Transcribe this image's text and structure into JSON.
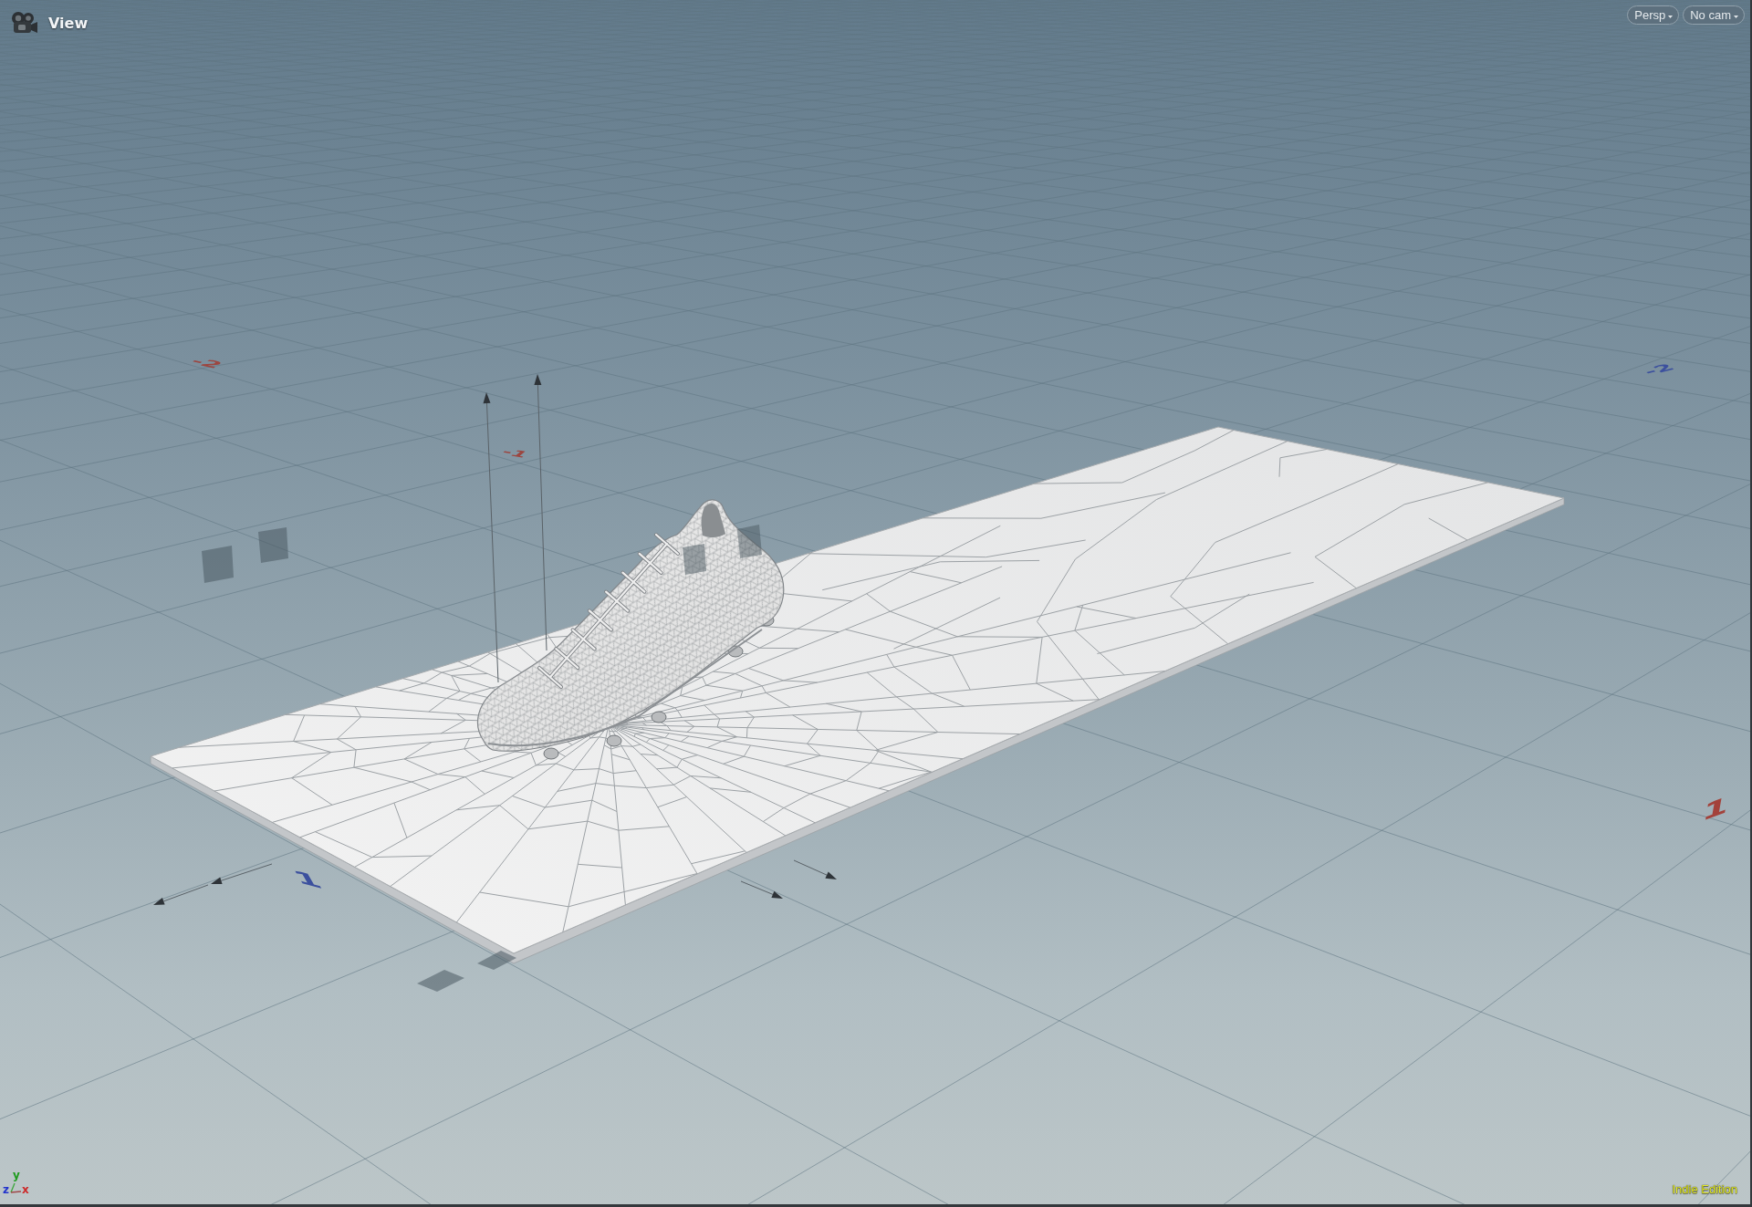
{
  "viewport": {
    "title": "View",
    "buttons": [
      {
        "label": "Persp"
      },
      {
        "label": "No cam"
      }
    ]
  },
  "grid_labels": [
    {
      "text": "-2",
      "color": "#9c4640"
    },
    {
      "text": "-2",
      "color": "#3c509e"
    },
    {
      "text": "-1",
      "color": "#9c4640"
    },
    {
      "text": "1",
      "color": "#a3423b"
    },
    {
      "text": "1",
      "color": "#3c509e"
    }
  ],
  "axis_gizmo": [
    {
      "label": "y",
      "color": "#1d9a1d"
    },
    {
      "label": "z",
      "color": "#2233cc"
    },
    {
      "label": "x",
      "color": "#cc2a2a"
    }
  ],
  "edition": "Indie Edition"
}
